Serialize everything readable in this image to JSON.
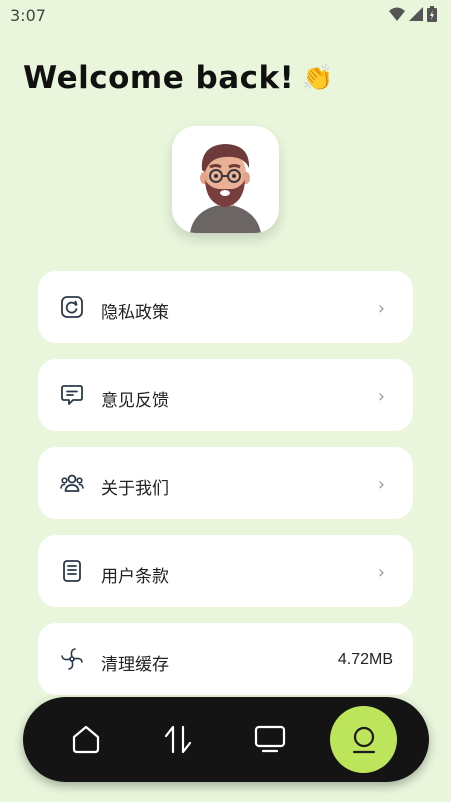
{
  "status": {
    "time": "3:07"
  },
  "header": {
    "title": "Welcome back!",
    "emoji": "👏"
  },
  "menu": [
    {
      "label": "隐私政策",
      "icon": "refresh-square-icon"
    },
    {
      "label": "意见反馈",
      "icon": "message-icon"
    },
    {
      "label": "关于我们",
      "icon": "people-icon"
    },
    {
      "label": "用户条款",
      "icon": "document-icon"
    },
    {
      "label": "清理缓存",
      "icon": "fan-icon",
      "value": "4.72MB"
    }
  ],
  "nav": {
    "items": [
      "home-icon",
      "transfer-icon",
      "tv-icon",
      "profile-icon"
    ],
    "active_color": "#bde55c",
    "bar_color": "#141414"
  },
  "colors": {
    "background": "#e9f6dc",
    "card": "#ffffff"
  }
}
